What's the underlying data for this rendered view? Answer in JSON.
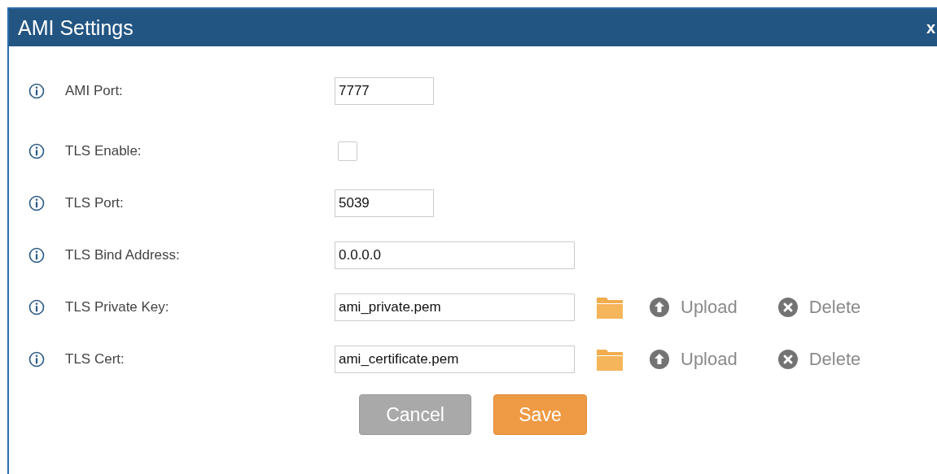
{
  "dialog": {
    "title": "AMI Settings",
    "close": "x"
  },
  "fields": [
    {
      "kind": "number",
      "label": "AMI Port:",
      "value": "7777"
    },
    {
      "kind": "checkbox",
      "label": "TLS Enable:",
      "checked": false
    },
    {
      "kind": "number",
      "label": "TLS Port:",
      "value": "5039"
    },
    {
      "kind": "text",
      "label": "TLS Bind Address:",
      "value": "0.0.0.0"
    },
    {
      "kind": "file",
      "label": "TLS Private Key:",
      "value": "ami_private.pem",
      "upload": "Upload",
      "delete": "Delete"
    },
    {
      "kind": "file",
      "label": "TLS Cert:",
      "value": "ami_certificate.pem",
      "upload": "Upload",
      "delete": "Delete"
    }
  ],
  "buttons": [
    {
      "label": "Cancel",
      "kind": "secondary"
    },
    {
      "label": "Save",
      "kind": "primary"
    }
  ]
}
